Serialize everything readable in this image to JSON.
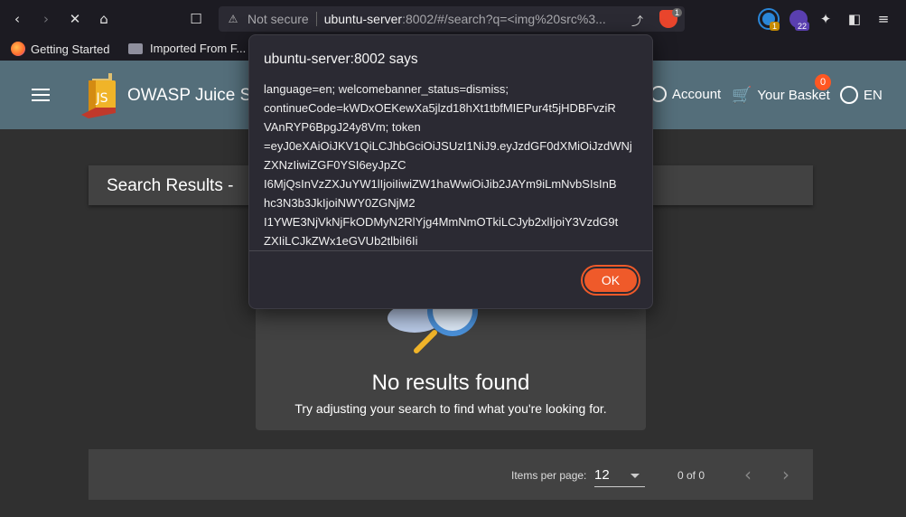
{
  "browser": {
    "url_security": "Not secure",
    "url_host": "ubuntu-server",
    "url_rest": ":8002/#/search?q=<img%20src%3...",
    "brave_count": "1",
    "ext1_badge": "1",
    "ext2_badge": "22"
  },
  "bookmarks": {
    "items": [
      {
        "label": "Getting Started"
      },
      {
        "label": "Imported From F..."
      }
    ]
  },
  "app": {
    "title": "OWASP Juice Sh",
    "account_label": "Account",
    "basket_label": "Your Basket",
    "basket_count": "0",
    "language_label": "EN"
  },
  "search": {
    "title": "Search Results -",
    "empty_title": "No results found",
    "empty_subtitle": "Try adjusting your search to find what you're looking for."
  },
  "pager": {
    "items_per_page_label": "Items per page:",
    "items_per_page_value": "12",
    "range": "0 of 0"
  },
  "dialog": {
    "title": "ubuntu-server:8002 says",
    "lines": [
      "language=en; welcomebanner_status=dismiss;",
      "continueCode=kWDxOEKewXa5jlzd18hXt1tbfMIEPur4t5jHDBFvziR",
      "VAnRYP6BpgJ24y8Vm; token",
      "=eyJ0eXAiOiJKV1QiLCJhbGciOiJSUzI1NiJ9.eyJzdGF0dXMiOiJzdWNj",
      "ZXNzIiwiZGF0YSI6eyJpZC",
      "I6MjQsInVzZXJuYW1lIjoiIiwiZW1haWwiOiJib2JAYm9iLmNvbSIsInB",
      "hc3N3b3JkIjoiNWY0ZGNjM2",
      "I1YWE3NjVkNjFkODMyN2RlYjg4MmNmOTkiLCJyb2xlIjoiY3VzdG9t",
      "ZXIiLCJkZWx1eGVUb2tlbiI6Ii"
    ],
    "ok_label": "OK"
  },
  "colors": {
    "header": "#546e7a",
    "accent": "#ff5722",
    "background": "#303030",
    "card": "#424242"
  }
}
